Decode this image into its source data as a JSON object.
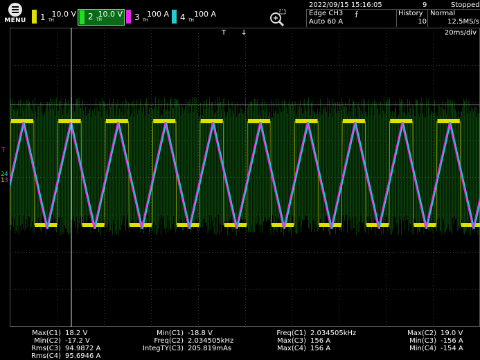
{
  "menu": {
    "label": "MENU"
  },
  "channels": [
    {
      "num": "1",
      "scale": "10.0 V",
      "coupling": "TH",
      "color": "#e0e000"
    },
    {
      "num": "2",
      "scale": "10.0 V",
      "coupling": "TH",
      "color": "#22dd22"
    },
    {
      "num": "3",
      "scale": "100 A",
      "coupling": "TH",
      "color": "#ee22ee"
    },
    {
      "num": "4",
      "scale": "100 A",
      "coupling": "TH",
      "color": "#22cccc"
    }
  ],
  "header": {
    "datetime": "2022/09/15 15:16:05",
    "acq_count": "9",
    "run_state": "Stopped",
    "trigger": "Edge CH3",
    "trigger_mode": "Auto 60 A",
    "history_label": "History",
    "history_value": "10",
    "acq_mode": "Normal",
    "sample_rate": "12.5MS/s",
    "timebase": "20ms/div"
  },
  "measurements": {
    "col1": [
      {
        "label": "Max(C1)",
        "value": "18.2 V"
      },
      {
        "label": "Min(C2)",
        "value": "-17.2 V"
      },
      {
        "label": "Rms(C3)",
        "value": "94.9872 A"
      },
      {
        "label": "Rms(C4)",
        "value": "95.6946 A"
      }
    ],
    "col2": [
      {
        "label": "Min(C1)",
        "value": "-18.8 V"
      },
      {
        "label": "Freq(C2)",
        "value": "2.034505kHz"
      },
      {
        "label": "IntegTY(C3)",
        "value": "205.819mAs"
      }
    ],
    "col3": [
      {
        "label": "Freq(C1)",
        "value": "2.034505kHz"
      },
      {
        "label": "Max(C3)",
        "value": "156 A"
      },
      {
        "label": "Max(C4)",
        "value": "156 A"
      }
    ],
    "col4": [
      {
        "label": "Max(C2)",
        "value": "19.0 V"
      },
      {
        "label": "Min(C3)",
        "value": "-156 A"
      },
      {
        "label": "Min(C4)",
        "value": "-154 A"
      }
    ]
  },
  "colors": {
    "grid": "#3a3a3a",
    "ch1": "#e0e000",
    "ch2": "#22dd22",
    "ch3": "#ee22ee",
    "ch4": "#22cccc"
  }
}
